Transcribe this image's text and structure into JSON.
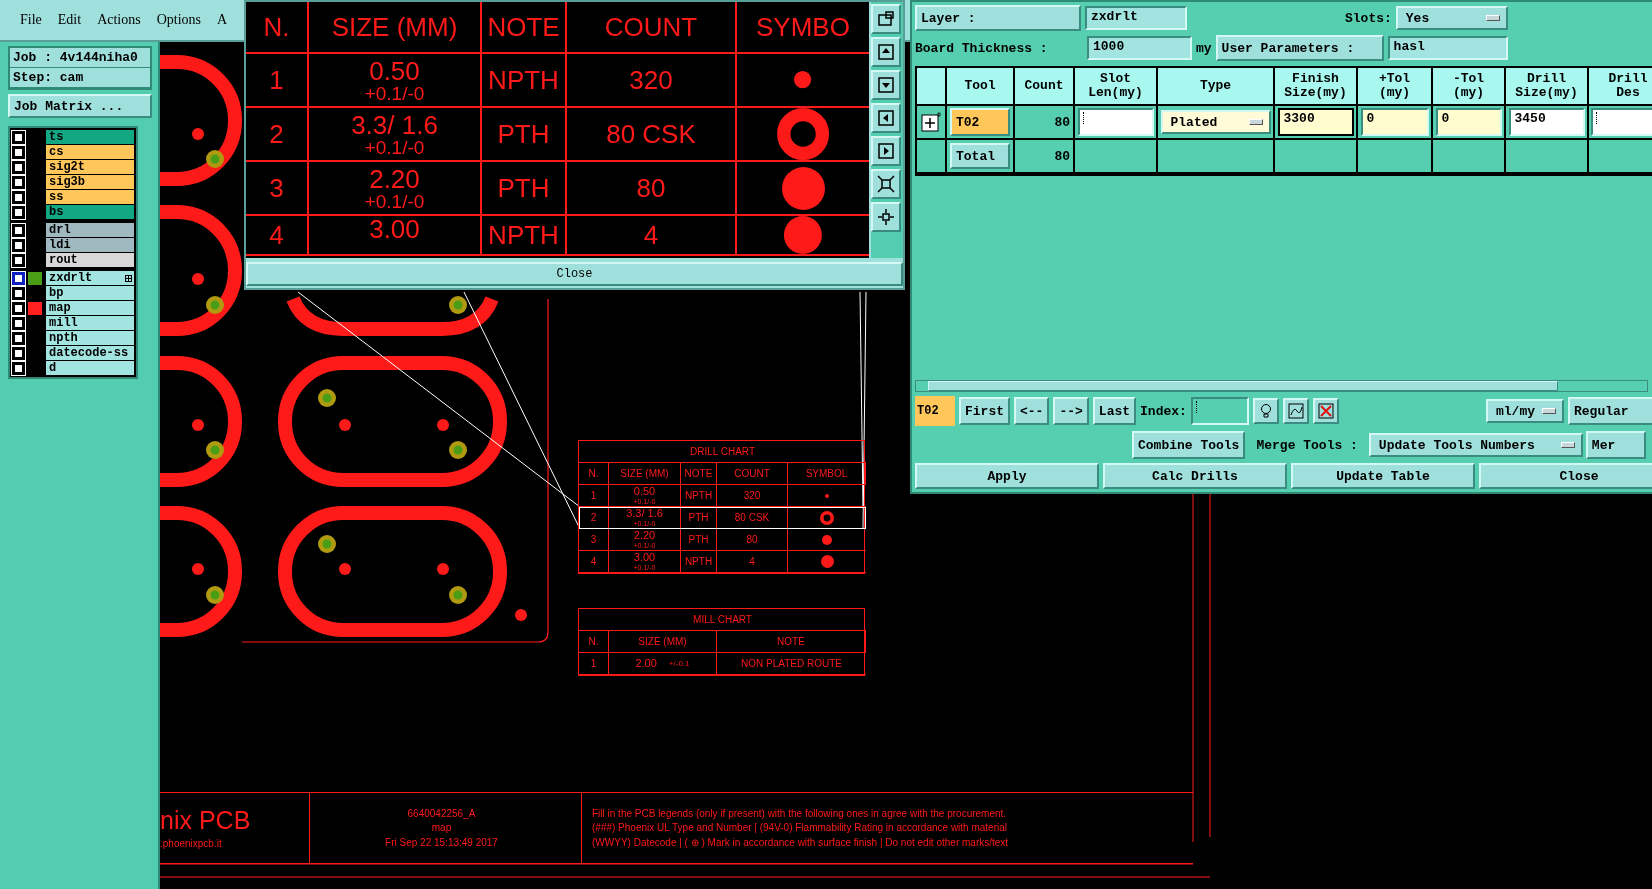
{
  "menu": [
    {
      "label": "File"
    },
    {
      "label": "Edit"
    },
    {
      "label": "Actions"
    },
    {
      "label": "Options"
    },
    {
      "label": "A"
    }
  ],
  "job": {
    "job": "Job : 4v144niha0",
    "step": "Step: cam",
    "matrix_button": "Job Matrix ..."
  },
  "layer_groups": [
    {
      "layers": [
        {
          "name": "ts",
          "kind": "mask",
          "checked": false,
          "selected": false
        },
        {
          "name": "cs",
          "kind": "signal",
          "checked": false,
          "selected": false
        },
        {
          "name": "sig2t",
          "kind": "signal",
          "checked": false,
          "selected": false
        },
        {
          "name": "sig3b",
          "kind": "signal",
          "checked": false,
          "selected": false
        },
        {
          "name": "ss",
          "kind": "signal",
          "checked": false,
          "selected": false
        },
        {
          "name": "bs",
          "kind": "mask",
          "checked": false,
          "selected": false
        }
      ]
    },
    {
      "layers": [
        {
          "name": "drl",
          "kind": "drill",
          "checked": false,
          "selected": false
        },
        {
          "name": "ldi",
          "kind": "drill",
          "checked": false,
          "selected": false
        },
        {
          "name": "rout",
          "kind": "rout",
          "checked": false,
          "selected": false
        }
      ]
    },
    {
      "layers": [
        {
          "name": "zxdrlt",
          "kind": "document",
          "color": "#4a9e16",
          "checked": false,
          "selected": true
        },
        {
          "name": "bp",
          "kind": "document",
          "checked": false,
          "selected": false
        },
        {
          "name": "map",
          "kind": "document",
          "color": "#ff2020",
          "checked": false,
          "selected": false
        },
        {
          "name": "mill",
          "kind": "document",
          "checked": false,
          "selected": false
        },
        {
          "name": "npth",
          "kind": "document",
          "checked": false,
          "selected": false
        },
        {
          "name": "datecode-ss",
          "kind": "document",
          "checked": false,
          "selected": false
        },
        {
          "name": "d",
          "kind": "document",
          "checked": false,
          "selected": false
        }
      ]
    }
  ],
  "zoom_window": {
    "columns": [
      "N.",
      "SIZE (MM)",
      "NOTE",
      "COUNT",
      "SYMBO"
    ],
    "rows": [
      {
        "n": "1",
        "size": "0.50",
        "tolerance": "+0.1/-0",
        "note": "NPTH",
        "count": "320",
        "kind": "dot"
      },
      {
        "n": "2",
        "size": "3.3/ 1.6",
        "tolerance": "+0.1/-0",
        "note": "PTH",
        "count": "80 CSK",
        "kind": "ring"
      },
      {
        "n": "3",
        "size": "2.20",
        "tolerance": "+0.1/-0",
        "note": "PTH",
        "count": "80",
        "kind": "disc"
      },
      {
        "n": "4",
        "size": "3.00",
        "note": "NPTH",
        "count": "4",
        "kind": "large"
      }
    ],
    "close_button": "Close"
  },
  "drill_dialog": {
    "layer_button": "Layer :",
    "layer_value": "zxdrlt",
    "slots_label": "Slots:",
    "slots_value": "Yes",
    "thickness_label": "Board Thickness :",
    "thickness_value": "1000",
    "thickness_unit": "my",
    "user_params_button": "User Parameters :",
    "user_params_value": "hasl",
    "columns": [
      "Tool",
      "Count",
      "Slot\nLen(my)",
      "Type",
      "Finish\nSize(my)",
      "+Tol\n(my)",
      "-Tol\n(my)",
      "Drill\nSize(my)",
      "Drill\nDes"
    ],
    "tools": [
      {
        "tool": "T02",
        "count": "80",
        "type": "Plated",
        "finish_size": "3300",
        "plus_tol": "0",
        "minus_tol": "0",
        "drill_size": "3450"
      }
    ],
    "total": {
      "label": "Total",
      "count": "80"
    },
    "nav": {
      "current": "T02",
      "buttons": [
        "First",
        "<--",
        "-->",
        "Last"
      ],
      "index_label": "Index:",
      "units": "ml/my",
      "mode": "Regular"
    },
    "merge": {
      "combine_button": "Combine Tools",
      "merge_label": "Merge Tools :",
      "merge_value": "Update Tools Numbers",
      "extra_button": "Mer"
    },
    "actions": [
      "Apply",
      "Calc Drills",
      "Update Table",
      "Close"
    ]
  },
  "drill_chart": {
    "title": "DRILL CHART",
    "columns": [
      "N.",
      "SIZE (MM)",
      "NOTE",
      "COUNT",
      "SYMBOL"
    ],
    "rows": [
      {
        "n": "1",
        "size": "0.50",
        "tolerance": "+0.1/-0",
        "note": "NPTH",
        "count": "320",
        "kind": "dot",
        "selected": false
      },
      {
        "n": "2",
        "size": "3.3/ 1.6",
        "tolerance": "+0.1/-0",
        "note": "PTH",
        "count": "80 CSK",
        "kind": "ring",
        "selected": true
      },
      {
        "n": "3",
        "size": "2.20",
        "tolerance": "+0.1/-0",
        "note": "PTH",
        "count": "80",
        "kind": "disc",
        "selected": false
      },
      {
        "n": "4",
        "size": "3.00",
        "tolerance": "+0.1/-0",
        "note": "NPTH",
        "count": "4",
        "kind": "large",
        "selected": false
      }
    ]
  },
  "mill_chart": {
    "title": "MILL CHART",
    "columns": [
      "N.",
      "SIZE (MM)",
      "NOTE"
    ],
    "rows": [
      {
        "n": "1",
        "size": "2.00",
        "tolerance": "+/-0.1",
        "note": "NON PLATED ROUTE"
      }
    ]
  },
  "title_block": {
    "logo": "nix PCB",
    "website": ".phoenixpcb.it",
    "part_number": "6640042256_A",
    "layer": "map",
    "date": "Fri Sep 22 15:13:49 2017",
    "notes": [
      "Fill in the PCB legends (only if present) with the following ones in agree with the procurement.",
      "(###) Phoenix UL Type and Number | (94V-0) Flammability Rating in accordance with material",
      "(WWYY) Datecode | ( ⊕ ) Mark in accordance with surface finish | Do not edit other marks/text"
    ]
  }
}
